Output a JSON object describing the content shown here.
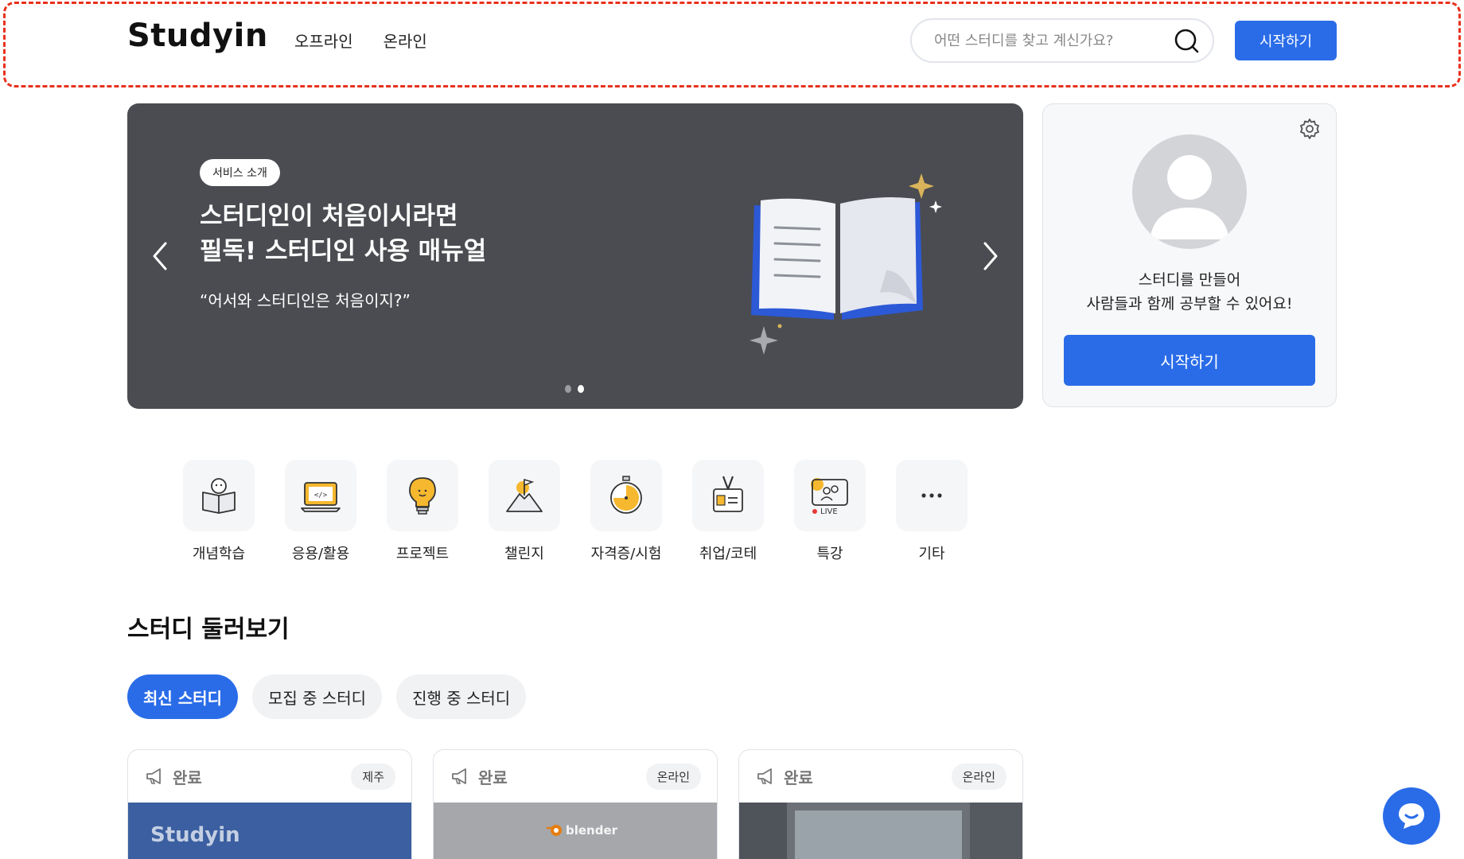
{
  "header": {
    "logo": "Studyin",
    "nav": [
      "오프라인",
      "온라인"
    ],
    "search_placeholder": "어떤 스터디를 찾고 계신가요?",
    "start_label": "시작하기"
  },
  "banner": {
    "badge": "서비스 소개",
    "title_line1": "스터디인이 처음이시라면",
    "title_line2": "필독! 스터디인 사용 매뉴얼",
    "quote": "“어서와 스터디인은 처음이지?”",
    "slide_count": 2,
    "active_slide": 2
  },
  "profile": {
    "text_line1": "스터디를 만들어",
    "text_line2": "사람들과 함께 공부할 수 있어요!",
    "start_label": "시작하기"
  },
  "categories": [
    {
      "label": "개념학습",
      "icon": "book-reading-icon"
    },
    {
      "label": "응용/활용",
      "icon": "laptop-code-icon"
    },
    {
      "label": "프로젝트",
      "icon": "lightbulb-icon"
    },
    {
      "label": "챌린지",
      "icon": "mountain-flag-icon"
    },
    {
      "label": "자격증/시험",
      "icon": "stopwatch-icon"
    },
    {
      "label": "취업/코테",
      "icon": "id-badge-icon"
    },
    {
      "label": "특강",
      "icon": "live-icon",
      "live_text": "LIVE"
    },
    {
      "label": "기타",
      "icon": "more-icon"
    }
  ],
  "section": {
    "title": "스터디 둘러보기",
    "tabs": [
      "최신 스터디",
      "모집 중 스터디",
      "진행 중 스터디"
    ]
  },
  "cards": [
    {
      "status": "완료",
      "region": "제주",
      "thumb_text": "Studyin"
    },
    {
      "status": "완료",
      "region": "온라인",
      "thumb_text": "blender"
    },
    {
      "status": "완료",
      "region": "온라인",
      "thumb_text": ""
    }
  ],
  "colors": {
    "accent": "#2a6ce8",
    "banner_bg": "#4a4c51"
  }
}
